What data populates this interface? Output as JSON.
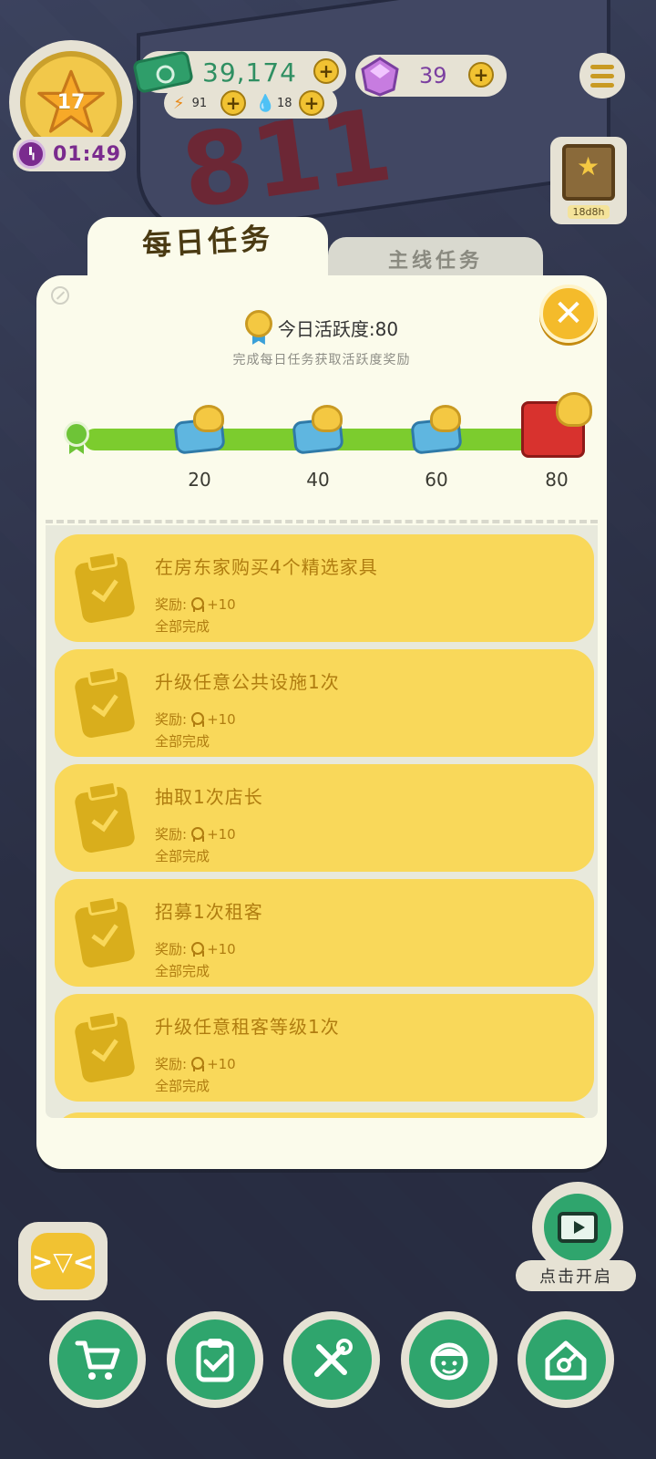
{
  "hud": {
    "level": "17",
    "timer": "01:49",
    "cash": "39,174",
    "energy": "91",
    "water": "18",
    "gems": "39",
    "book_timer": "18d8h"
  },
  "tabs": {
    "daily": "每日任务",
    "main": "主线任务"
  },
  "activity": {
    "title": "今日活跃度:80",
    "subtitle": "完成每日任务获取活跃度奖励",
    "milestones": [
      "20",
      "40",
      "60",
      "80"
    ]
  },
  "tasks": [
    {
      "title": "在房东家购买4个精选家具",
      "reward": "奖励:",
      "reward_value": "+10",
      "status": "全部完成"
    },
    {
      "title": "升级任意公共设施1次",
      "reward": "奖励:",
      "reward_value": "+10",
      "status": "全部完成"
    },
    {
      "title": "抽取1次店长",
      "reward": "奖励:",
      "reward_value": "+10",
      "status": "全部完成"
    },
    {
      "title": "招募1次租客",
      "reward": "奖励:",
      "reward_value": "+10",
      "status": "全部完成"
    },
    {
      "title": "升级任意租客等级1次",
      "reward": "奖励:",
      "reward_value": "+10",
      "status": "全部完成"
    }
  ],
  "tv": {
    "label": "点击开启"
  },
  "colors": {
    "panel": "#fbfbeb",
    "task_card": "#f9d85a",
    "task_text": "#b07d10",
    "progress": "#7ccc2e",
    "nav_green": "#2fa56d",
    "close_button": "#f4bb2b"
  },
  "icons": {
    "nav": [
      "cart-icon",
      "clipboard-icon",
      "tools-icon",
      "character-icon",
      "home-key-icon"
    ]
  }
}
